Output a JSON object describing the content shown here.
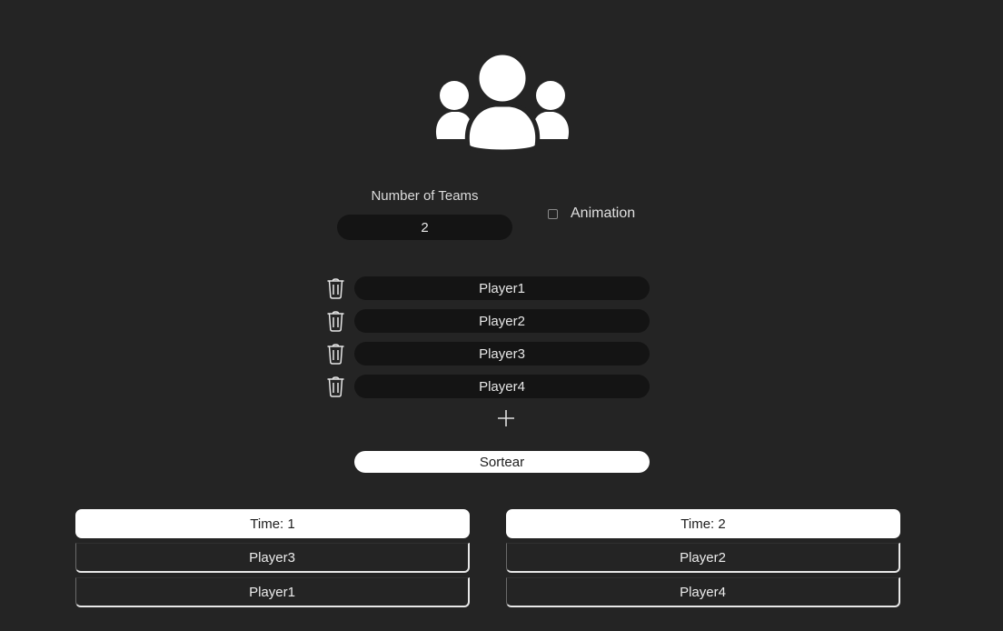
{
  "logo": {
    "icon": "users-group-icon"
  },
  "teams": {
    "label": "Number of Teams",
    "value": "2"
  },
  "animation": {
    "label": "Animation",
    "checked": false
  },
  "players": [
    {
      "name": "Player1",
      "icon": "trash-icon"
    },
    {
      "name": "Player2",
      "icon": "trash-icon"
    },
    {
      "name": "Player3",
      "icon": "trash-icon"
    },
    {
      "name": "Player4",
      "icon": "trash-icon"
    }
  ],
  "add_player": {
    "icon": "plus-icon"
  },
  "sort_button": {
    "label": "Sortear"
  },
  "results": [
    {
      "header": "Time: 1",
      "members": [
        "Player3",
        "Player1"
      ]
    },
    {
      "header": "Time: 2",
      "members": [
        "Player2",
        "Player4"
      ]
    }
  ],
  "colors": {
    "background": "#242424",
    "field": "#141414",
    "button": "#ffffff"
  }
}
